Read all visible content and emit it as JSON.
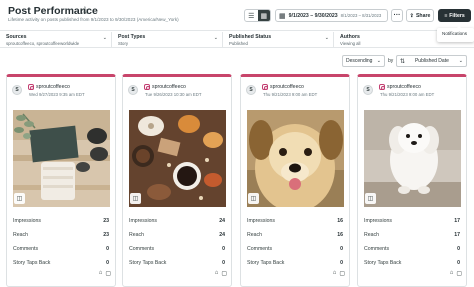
{
  "header": {
    "title": "Post Performance",
    "subtitle": "Lifetime activity on posts published from 9/1/2023 to 9/30/2023 (America/New_York)",
    "date_range": "9/1/2023 – 9/30/2023",
    "compare_range": "8/1/2023 – 8/31/2023",
    "share_label": "Share",
    "filters_label": "Filters",
    "tooltip": "Notifications"
  },
  "filters": [
    {
      "label": "Sources",
      "value": "sproutcoffeeco, sproutcoffeeworldwide"
    },
    {
      "label": "Post Types",
      "value": "Story"
    },
    {
      "label": "Published Status",
      "value": "Published"
    },
    {
      "label": "Authors",
      "value": "Viewing all"
    }
  ],
  "sort": {
    "order": "Descending",
    "by_label": "by",
    "field": "Published Date"
  },
  "metric_labels": [
    "Impressions",
    "Reach",
    "Comments",
    "Story Taps Back"
  ],
  "cards": [
    {
      "avatar": "S",
      "account": "sproutcoffeeco",
      "published": "Wed 9/27/2023 9:35 am EDT",
      "metrics": [
        "23",
        "23",
        "0",
        "0"
      ]
    },
    {
      "avatar": "S",
      "account": "sproutcoffeeco",
      "published": "Tue 9/26/2023 10:30 am EDT",
      "metrics": [
        "24",
        "24",
        "0",
        "0"
      ]
    },
    {
      "avatar": "S",
      "account": "sproutcoffeeco",
      "published": "Thu 9/21/2023 9:00 am EDT",
      "metrics": [
        "16",
        "16",
        "0",
        "0"
      ]
    },
    {
      "avatar": "S",
      "account": "sproutcoffeeco",
      "published": "Thu 9/21/2023 9:00 am EDT",
      "metrics": [
        "17",
        "17",
        "0",
        "0"
      ]
    }
  ],
  "colors": {
    "accent": "#c8456b",
    "dark_button": "#273135",
    "instagram": "#c23d70"
  },
  "icons": [
    "star-icon",
    "list-view-icon",
    "grid-view-icon",
    "calendar-icon",
    "more-icon",
    "share-icon",
    "filter-icon",
    "instagram-icon",
    "camera-icon",
    "tag-icon",
    "comment-icon",
    "chevron-down-icon",
    "sort-icon"
  ]
}
